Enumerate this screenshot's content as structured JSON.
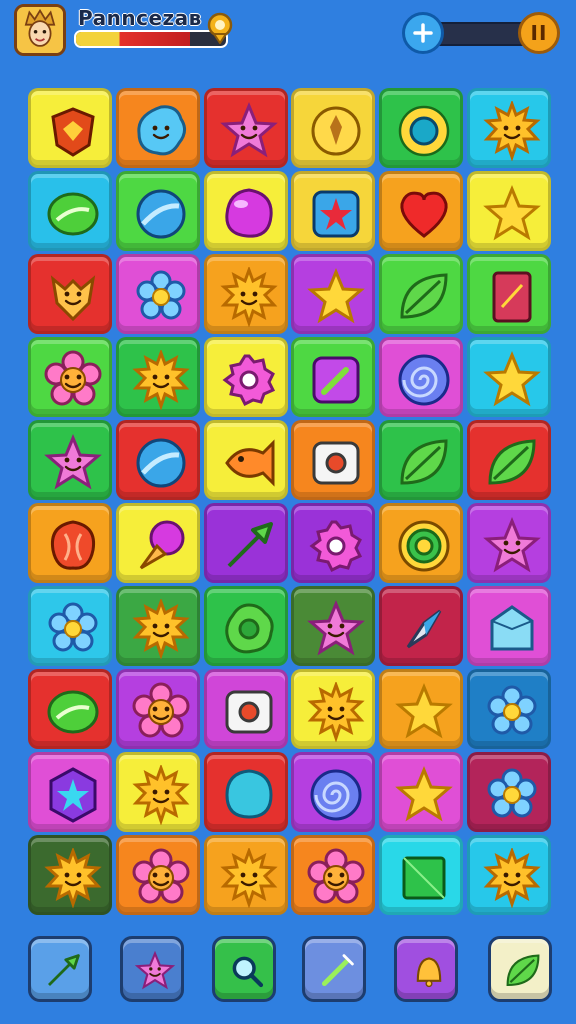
{
  "header": {
    "title": "Panncezaв",
    "progress_fraction": 0.38,
    "pause_label": "II"
  },
  "colors": {
    "background": "#2f7fe0",
    "bar_yellow": "#f3d23a",
    "bar_red": "#e4312b"
  },
  "board": {
    "rows": [
      [
        {
          "bg": "#f6ee3a",
          "icon": "crest-icon"
        },
        {
          "bg": "#f6861e",
          "icon": "blob-smile-icon"
        },
        {
          "bg": "#e5312e",
          "icon": "star-face-icon"
        },
        {
          "bg": "#f6d63a",
          "icon": "emblem-icon"
        },
        {
          "bg": "#2ec24a",
          "icon": "sun-ring-icon"
        },
        {
          "bg": "#27c8ea",
          "icon": "sun-face-icon"
        }
      ],
      [
        {
          "bg": "#29c0ea",
          "icon": "leaf-orb-icon"
        },
        {
          "bg": "#4ed843",
          "icon": "ball-icon"
        },
        {
          "bg": "#f6ee3a",
          "icon": "gem-blob-icon"
        },
        {
          "bg": "#f6d63a",
          "icon": "star-card-icon"
        },
        {
          "bg": "#f6a21e",
          "icon": "heart-icon"
        },
        {
          "bg": "#f6ee3a",
          "icon": "star-icon"
        }
      ],
      [
        {
          "bg": "#e5312e",
          "icon": "fox-icon"
        },
        {
          "bg": "#e04fd6",
          "icon": "flower-icon"
        },
        {
          "bg": "#f6a21e",
          "icon": "sun-face-icon"
        },
        {
          "bg": "#b53fe0",
          "icon": "star-icon"
        },
        {
          "bg": "#4ed843",
          "icon": "leaf-icon"
        },
        {
          "bg": "#4ed843",
          "icon": "card-icon"
        }
      ],
      [
        {
          "bg": "#4ed843",
          "icon": "flower-face-icon"
        },
        {
          "bg": "#2ec24a",
          "icon": "sun-face-icon"
        },
        {
          "bg": "#f6ee3a",
          "icon": "gear-icon"
        },
        {
          "bg": "#4ed843",
          "icon": "wand-box-icon"
        },
        {
          "bg": "#e04fd6",
          "icon": "swirl-icon"
        },
        {
          "bg": "#27c8ea",
          "icon": "star-icon"
        }
      ],
      [
        {
          "bg": "#2ec24a",
          "icon": "star-face-icon"
        },
        {
          "bg": "#e5312e",
          "icon": "ball-icon"
        },
        {
          "bg": "#f6ee3a",
          "icon": "fish-icon"
        },
        {
          "bg": "#f6861e",
          "icon": "camera-icon"
        },
        {
          "bg": "#2ec24a",
          "icon": "leaf-icon"
        },
        {
          "bg": "#e5312e",
          "icon": "leaf-icon"
        }
      ],
      [
        {
          "bg": "#f6a21e",
          "icon": "shell-icon"
        },
        {
          "bg": "#f6ee3a",
          "icon": "cone-icon"
        },
        {
          "bg": "#9a32d8",
          "icon": "arrow-icon"
        },
        {
          "bg": "#9a32d8",
          "icon": "gear-icon"
        },
        {
          "bg": "#f6a21e",
          "icon": "target-icon"
        },
        {
          "bg": "#b53fe0",
          "icon": "star-face-icon"
        }
      ],
      [
        {
          "bg": "#2ec7ea",
          "icon": "flower-icon"
        },
        {
          "bg": "#3ba844",
          "icon": "sun-face-icon"
        },
        {
          "bg": "#2ec24a",
          "icon": "ring-icon"
        },
        {
          "bg": "#4a8a36",
          "icon": "star-face-icon"
        },
        {
          "bg": "#c2244a",
          "icon": "compass-icon"
        },
        {
          "bg": "#e04fd6",
          "icon": "crystal-icon"
        }
      ],
      [
        {
          "bg": "#e5312e",
          "icon": "leaf-orb-icon"
        },
        {
          "bg": "#b53fe0",
          "icon": "flower-face-icon"
        },
        {
          "bg": "#d046d8",
          "icon": "camera-icon"
        },
        {
          "bg": "#f6ee3a",
          "icon": "sun-face-icon"
        },
        {
          "bg": "#f6a21e",
          "icon": "star-icon"
        },
        {
          "bg": "#1f7fc6",
          "icon": "flower-icon"
        }
      ],
      [
        {
          "bg": "#e04fd6",
          "icon": "hex-star-icon"
        },
        {
          "bg": "#f6ee3a",
          "icon": "sun-face-icon"
        },
        {
          "bg": "#e5312e",
          "icon": "blob-icon"
        },
        {
          "bg": "#b53fe0",
          "icon": "swirl-icon"
        },
        {
          "bg": "#e04fd6",
          "icon": "star-icon"
        },
        {
          "bg": "#b3245a",
          "icon": "flower-icon"
        }
      ],
      [
        {
          "bg": "#3b6a2e",
          "icon": "sun-face-icon"
        },
        {
          "bg": "#f6861e",
          "icon": "flower-face-icon"
        },
        {
          "bg": "#f6a21e",
          "icon": "sun-face-icon"
        },
        {
          "bg": "#f6861e",
          "icon": "flower-face-icon"
        },
        {
          "bg": "#29d8e8",
          "icon": "square-gem-icon"
        },
        {
          "bg": "#27c8ea",
          "icon": "sun-face-icon"
        }
      ]
    ]
  },
  "toolbar": {
    "tools": [
      {
        "icon": "arrow-icon",
        "bg": "#5aa0e8"
      },
      {
        "icon": "star-face-icon",
        "bg": "#4a7fcf"
      },
      {
        "icon": "search-icon",
        "bg": "#35c04a"
      },
      {
        "icon": "wand-icon",
        "bg": "#6d8fe0"
      },
      {
        "icon": "bell-icon",
        "bg": "#a04fe0"
      },
      {
        "icon": "leaf-icon",
        "bg": "#f3f0c8"
      }
    ]
  }
}
